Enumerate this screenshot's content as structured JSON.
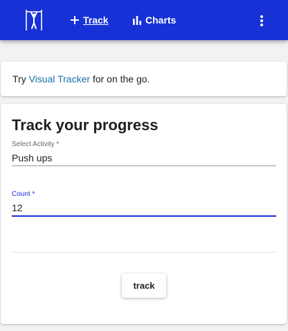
{
  "appbar": {
    "logo_icon": "exercise-figure-icon",
    "nav": [
      {
        "label": "Track",
        "icon": "plus-icon"
      },
      {
        "label": "Charts",
        "icon": "bar-chart-icon"
      }
    ],
    "menu_icon": "vertical-dots-icon",
    "color": "#1731d6"
  },
  "promo": {
    "prefix": "Try ",
    "link": "Visual Tracker",
    "suffix": " for on the go."
  },
  "form": {
    "title": "Track your progress",
    "activity": {
      "label": "Select Activity *",
      "value": "Push ups"
    },
    "count": {
      "label": "Count *",
      "value": "12"
    },
    "submit_label": "track"
  }
}
